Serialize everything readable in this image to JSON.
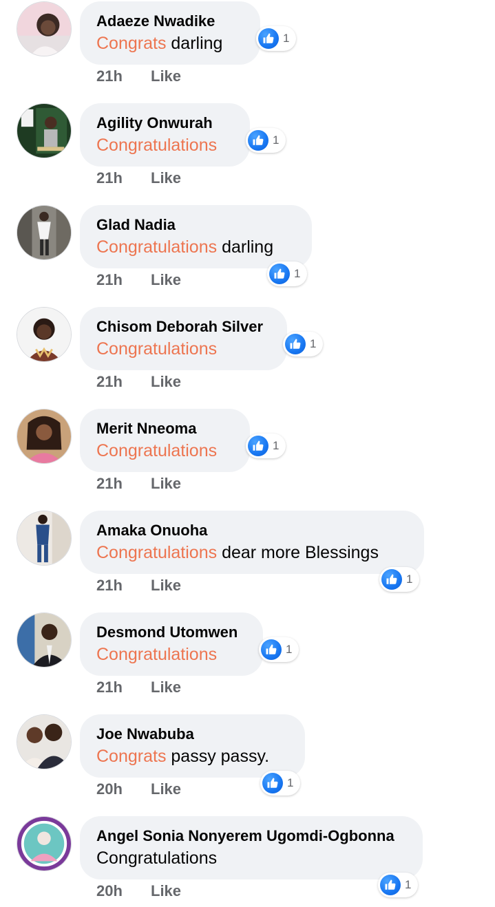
{
  "comments": [
    {
      "author": "Adaeze Nwadike",
      "hl": "Congrats",
      "rest": " darling",
      "time": "21h",
      "like_label": "Like",
      "reaction_count": "1"
    },
    {
      "author": "Agility Onwurah",
      "hl": "Congratulations",
      "rest": "",
      "time": "21h",
      "like_label": "Like",
      "reaction_count": "1"
    },
    {
      "author": "Glad Nadia",
      "hl": "Congratulations",
      "rest": " darling",
      "time": "21h",
      "like_label": "Like",
      "reaction_count": "1"
    },
    {
      "author": "Chisom Deborah Silver",
      "hl": "Congratulations",
      "rest": "",
      "time": "21h",
      "like_label": "Like",
      "reaction_count": "1"
    },
    {
      "author": "Merit Nneoma",
      "hl": "Congratulations",
      "rest": "",
      "time": "21h",
      "like_label": "Like",
      "reaction_count": "1"
    },
    {
      "author": "Amaka Onuoha",
      "hl": "Congratulations",
      "rest": " dear more Blessings",
      "time": "21h",
      "like_label": "Like",
      "reaction_count": "1"
    },
    {
      "author": "Desmond Utomwen",
      "hl": "Congratulations",
      "rest": "",
      "time": "21h",
      "like_label": "Like",
      "reaction_count": "1"
    },
    {
      "author": "Joe Nwabuba",
      "hl": "Congrats",
      "rest": " passy passy.",
      "time": "20h",
      "like_label": "Like",
      "reaction_count": "1"
    },
    {
      "author": "Angel Sonia Nonyerem Ugomdi-Ogbonna",
      "hl": "",
      "rest": "Congratulations",
      "time": "20h",
      "like_label": "Like",
      "reaction_count": "1"
    }
  ],
  "colors": {
    "highlight": "#ed7550",
    "like_blue": "#1877f2",
    "bubble_bg": "#f0f2f5",
    "meta_gray": "#65676b"
  },
  "icons": {
    "reaction": "thumbs-up-icon",
    "avatar": "profile-photo"
  }
}
